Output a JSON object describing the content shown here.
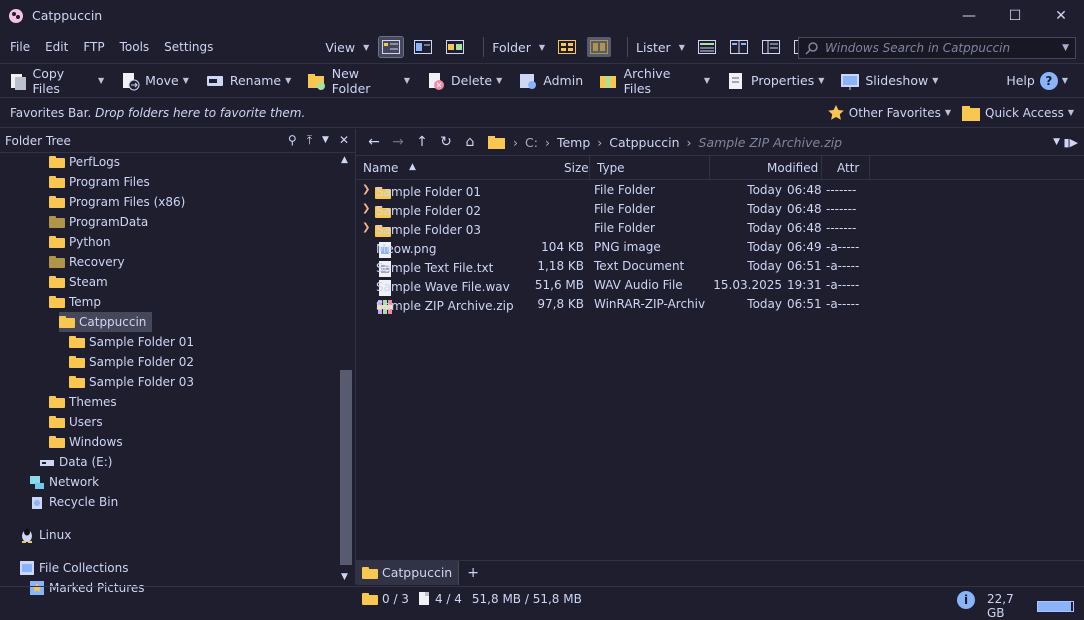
{
  "window": {
    "title": "Catppuccin",
    "minimize": "—",
    "maximize": "☐",
    "close": "✕"
  },
  "menu": [
    "File",
    "Edit",
    "FTP",
    "Tools",
    "Settings"
  ],
  "menu_underline": [
    "F",
    "E",
    "T",
    "T",
    "S"
  ],
  "viewbar": {
    "view_label": "View",
    "folder_label": "Folder",
    "lister_label": "Lister"
  },
  "search": {
    "placeholder": "Windows Search in Catppuccin"
  },
  "toolbar": {
    "copy": "Copy Files",
    "move": "Move",
    "rename": "Rename",
    "new_folder": "New Folder",
    "delete": "Delete",
    "admin": "Admin",
    "archive": "Archive Files",
    "properties": "Properties",
    "slideshow": "Slideshow",
    "help": "Help"
  },
  "favbar": {
    "text_plain": "Favorites Bar.",
    "text_italic": "Drop folders here to favorite them.",
    "other": "Other Favorites",
    "quick": "Quick Access"
  },
  "tree": {
    "title": "Folder Tree",
    "items": [
      {
        "label": "PerfLogs",
        "color": "yellow"
      },
      {
        "label": "Program Files",
        "color": "yellow"
      },
      {
        "label": "Program Files (x86)",
        "color": "yellow"
      },
      {
        "label": "ProgramData",
        "color": "dim"
      },
      {
        "label": "Python",
        "color": "yellow"
      },
      {
        "label": "Recovery",
        "color": "dim"
      },
      {
        "label": "Steam",
        "color": "yellow"
      },
      {
        "label": "Temp",
        "color": "yellow"
      },
      {
        "label": "Catppuccin",
        "color": "yellow",
        "selected": true
      },
      {
        "label": "Sample Folder 01",
        "color": "yellow"
      },
      {
        "label": "Sample Folder 02",
        "color": "yellow"
      },
      {
        "label": "Sample Folder 03",
        "color": "yellow"
      },
      {
        "label": "Themes",
        "color": "yellow"
      },
      {
        "label": "Users",
        "color": "yellow"
      },
      {
        "label": "Windows",
        "color": "yellow"
      },
      {
        "label": "Data (E:)",
        "icon": "drive-icon"
      },
      {
        "label": "Network",
        "icon": "network-icon"
      },
      {
        "label": "Recycle Bin",
        "icon": "recycle-bin-icon"
      },
      {
        "label": "Linux",
        "icon": "linux-icon"
      },
      {
        "label": "File Collections",
        "icon": "collections-icon"
      },
      {
        "label": "Marked Pictures",
        "icon": "star-icon"
      }
    ]
  },
  "nav": {
    "path": [
      "C:",
      "Temp",
      "Catppuccin",
      "Sample ZIP Archive.zip"
    ]
  },
  "columns": {
    "name": "Name",
    "size": "Size",
    "type": "Type",
    "modified": "Modified",
    "attr": "Attr"
  },
  "files": [
    {
      "name": "Sample Folder 01",
      "size": "",
      "type": "File Folder",
      "date": "Today",
      "time": "06:48",
      "attr": "-------",
      "kind": "folder"
    },
    {
      "name": "Sample Folder 02",
      "size": "",
      "type": "File Folder",
      "date": "Today",
      "time": "06:48",
      "attr": "-------",
      "kind": "folder"
    },
    {
      "name": "Sample Folder 03",
      "size": "",
      "type": "File Folder",
      "date": "Today",
      "time": "06:48",
      "attr": "-------",
      "kind": "folder"
    },
    {
      "name": "Meow.png",
      "size": "104 KB",
      "type": "PNG image",
      "date": "Today",
      "time": "06:49",
      "attr": "-a-----",
      "kind": "png",
      "selected": true
    },
    {
      "name": "Sample Text File.txt",
      "size": "1,18 KB",
      "type": "Text Document",
      "date": "Today",
      "time": "06:51",
      "attr": "-a-----",
      "kind": "txt",
      "selected": true
    },
    {
      "name": "Sample Wave File.wav",
      "size": "51,6 MB",
      "type": "WAV Audio File",
      "date": "15.03.2025",
      "time": "19:31",
      "attr": "-a-----",
      "kind": "wav",
      "selected": true
    },
    {
      "name": "Sample ZIP Archive.zip",
      "size": "97,8 KB",
      "type": "WinRAR-ZIP-Archiv",
      "date": "Today",
      "time": "06:51",
      "attr": "-a-----",
      "kind": "zip",
      "selected": true
    }
  ],
  "tabs": [
    {
      "label": "Catppuccin"
    }
  ],
  "tab_add": "+",
  "status": {
    "folders": "0 / 3",
    "files": "4 / 4",
    "size": "51,8 MB / 51,8 MB",
    "disk": "22,7 GB",
    "disk_used_fraction": 0.95
  },
  "colors": {
    "background": "#1e1e2e",
    "text": "#cdd6f4",
    "folder": "#f9c74f",
    "accent": "#89b4fa",
    "selection": "#45475a"
  }
}
